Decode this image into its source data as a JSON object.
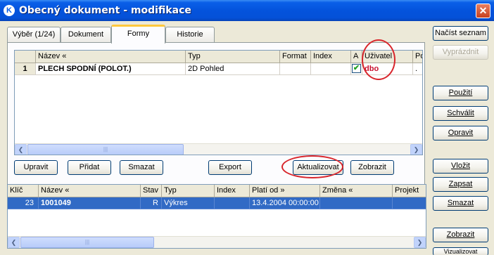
{
  "window": {
    "title": "Obecný dokument - modifikace",
    "app_icon": "K",
    "close": "✕"
  },
  "tabs": [
    {
      "label": "Výběr (1/24)"
    },
    {
      "label": "Dokument"
    },
    {
      "label": "Formy"
    },
    {
      "label": "Historie"
    }
  ],
  "forms_grid": {
    "columns": [
      "Název «",
      "Typ",
      "Format",
      "Index",
      "A",
      "Uživatel",
      "Po"
    ],
    "row": {
      "num": "1",
      "nazev": "PLECH SPODNÍ (POLOT.)",
      "typ": "2D Pohled",
      "format": "",
      "index": "",
      "a_checked": "✔",
      "uzivatel": "dbo",
      "extra": "."
    }
  },
  "forms_buttons": {
    "upravit": "Upravit",
    "pridat": "Přidat",
    "smazat": "Smazat",
    "export": "Export",
    "aktualizovat": "Aktualizovat",
    "zobrazit": "Zobrazit"
  },
  "history_grid": {
    "columns": [
      "Klíč",
      "Název «",
      "Stav",
      "Typ",
      "Index",
      "Platí od »",
      "Změna «",
      "Projekt"
    ],
    "row": {
      "klic": "23",
      "nazev": "1001049",
      "stav": "R",
      "typ": "Výkres",
      "index": "",
      "plati_od": "13.4.2004 00:00:00",
      "zmena": "",
      "projekt": ""
    }
  },
  "side_buttons": {
    "nacist": "Načíst seznam",
    "vyprazdnit": "Vyprázdnit",
    "pouziti": "Použití",
    "schvalit": "Schválit",
    "opravit": "Opravit",
    "vlozit": "Vložit",
    "zapsat": "Zapsat",
    "smazat": "Smazat",
    "zobrazit": "Zobrazit",
    "partial": "Vizualizovat"
  },
  "scroll": {
    "left": "❮",
    "right": "❯",
    "grip": "|||"
  },
  "colors": {
    "selection": "#316AC5",
    "title": "#0453DC",
    "annotation": "#D8252B"
  }
}
